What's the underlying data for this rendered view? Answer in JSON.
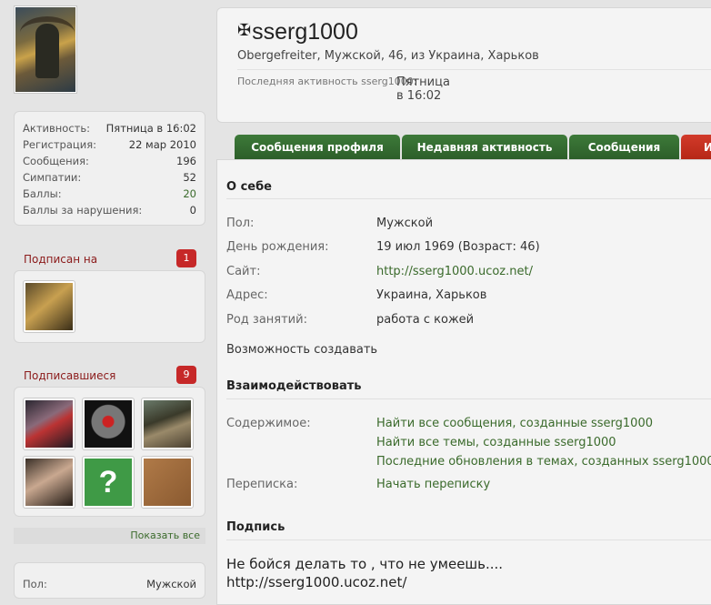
{
  "profile": {
    "name": "sserg1000",
    "title_line": "Obergefreiter, Мужской, 46, из Украина, Харьков",
    "last_activity_label": "Последняя активность sserg1000:",
    "last_activity_value": "Пятница в 16:02"
  },
  "stats": [
    {
      "label": "Активность:",
      "value": "Пятница в 16:02",
      "accent": false
    },
    {
      "label": "Регистрация:",
      "value": "22 мар 2010",
      "accent": false
    },
    {
      "label": "Сообщения:",
      "value": "196",
      "accent": false
    },
    {
      "label": "Симпатии:",
      "value": "52",
      "accent": false
    },
    {
      "label": "Баллы:",
      "value": "20",
      "accent": true
    },
    {
      "label": "Баллы за нарушения:",
      "value": "0",
      "accent": false
    }
  ],
  "following": {
    "title": "Подписан на",
    "count": "1"
  },
  "followers": {
    "title": "Подписавшиеся",
    "count": "9",
    "show_all": "Показать все"
  },
  "sidebar_gender": {
    "label": "Пол:",
    "value": "Мужской"
  },
  "tabs": [
    {
      "label": "Сообщения профиля"
    },
    {
      "label": "Недавняя активность"
    },
    {
      "label": "Сообщения"
    },
    {
      "label": "И"
    }
  ],
  "about": {
    "heading": "О себе",
    "rows": [
      {
        "label": "Пол:",
        "value": "Мужской",
        "link": false
      },
      {
        "label": "День рождения:",
        "value": "19 июл 1969 (Возраст: 46)",
        "link": false
      },
      {
        "label": "Сайт:",
        "value": "http://sserg1000.ucoz.net/",
        "link": true
      },
      {
        "label": "Адрес:",
        "value": "Украина, Харьков",
        "link": false
      },
      {
        "label": "Род занятий:",
        "value": "работа с кожей",
        "link": false
      }
    ],
    "extra": "Возможность создавать"
  },
  "interact": {
    "heading": "Взаимодействовать",
    "content_label": "Содержимое:",
    "content_links": [
      "Найти все сообщения, созданные sserg1000",
      "Найти все темы, созданные sserg1000",
      "Последние обновления в темах, созданных sserg1000"
    ],
    "conversation_label": "Переписка:",
    "conversation_link": "Начать переписку"
  },
  "signature": {
    "heading": "Подпись",
    "line1": "Не бойся делать то , что не умеешь....",
    "line2": "http://sserg1000.ucoz.net/"
  },
  "colors": {
    "accent_green": "#3a6a2b",
    "tab_green": "#2f6a2c",
    "badge_red": "#c62828"
  }
}
